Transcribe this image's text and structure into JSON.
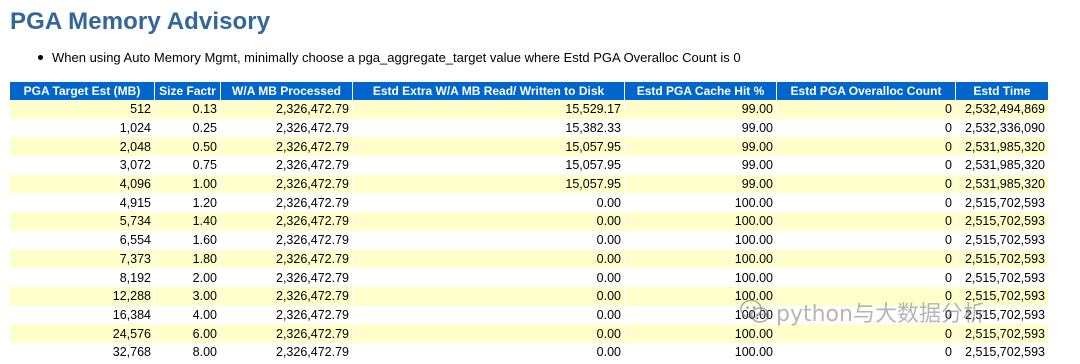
{
  "title": "PGA Memory Advisory",
  "note": "When using Auto Memory Mgmt, minimally choose a pga_aggregate_target value where Estd PGA Overalloc Count is 0",
  "colors": {
    "title": "#336699",
    "header_bg": "#0066CC",
    "odd_row_bg": "#FFFFCC"
  },
  "table": {
    "columns": [
      "PGA Target Est (MB)",
      "Size Factr",
      "W/A MB Processed",
      "Estd Extra W/A MB Read/ Written to Disk",
      "Estd PGA Cache Hit %",
      "Estd PGA Overalloc Count",
      "Estd Time"
    ],
    "rows": [
      [
        "512",
        "0.13",
        "2,326,472.79",
        "15,529.17",
        "99.00",
        "0",
        "2,532,494,869"
      ],
      [
        "1,024",
        "0.25",
        "2,326,472.79",
        "15,382.33",
        "99.00",
        "0",
        "2,532,336,090"
      ],
      [
        "2,048",
        "0.50",
        "2,326,472.79",
        "15,057.95",
        "99.00",
        "0",
        "2,531,985,320"
      ],
      [
        "3,072",
        "0.75",
        "2,326,472.79",
        "15,057.95",
        "99.00",
        "0",
        "2,531,985,320"
      ],
      [
        "4,096",
        "1.00",
        "2,326,472.79",
        "15,057.95",
        "99.00",
        "0",
        "2,531,985,320"
      ],
      [
        "4,915",
        "1.20",
        "2,326,472.79",
        "0.00",
        "100.00",
        "0",
        "2,515,702,593"
      ],
      [
        "5,734",
        "1.40",
        "2,326,472.79",
        "0.00",
        "100.00",
        "0",
        "2,515,702,593"
      ],
      [
        "6,554",
        "1.60",
        "2,326,472.79",
        "0.00",
        "100.00",
        "0",
        "2,515,702,593"
      ],
      [
        "7,373",
        "1.80",
        "2,326,472.79",
        "0.00",
        "100.00",
        "0",
        "2,515,702,593"
      ],
      [
        "8,192",
        "2.00",
        "2,326,472.79",
        "0.00",
        "100.00",
        "0",
        "2,515,702,593"
      ],
      [
        "12,288",
        "3.00",
        "2,326,472.79",
        "0.00",
        "100.00",
        "0",
        "2,515,702,593"
      ],
      [
        "16,384",
        "4.00",
        "2,326,472.79",
        "0.00",
        "100.00",
        "0",
        "2,515,702,593"
      ],
      [
        "24,576",
        "6.00",
        "2,326,472.79",
        "0.00",
        "100.00",
        "0",
        "2,515,702,593"
      ],
      [
        "32,768",
        "8.00",
        "2,326,472.79",
        "0.00",
        "100.00",
        "0",
        "2,515,702,593"
      ]
    ]
  },
  "watermark": {
    "text": "python与大数据分析",
    "icon": "wechat-icon"
  }
}
